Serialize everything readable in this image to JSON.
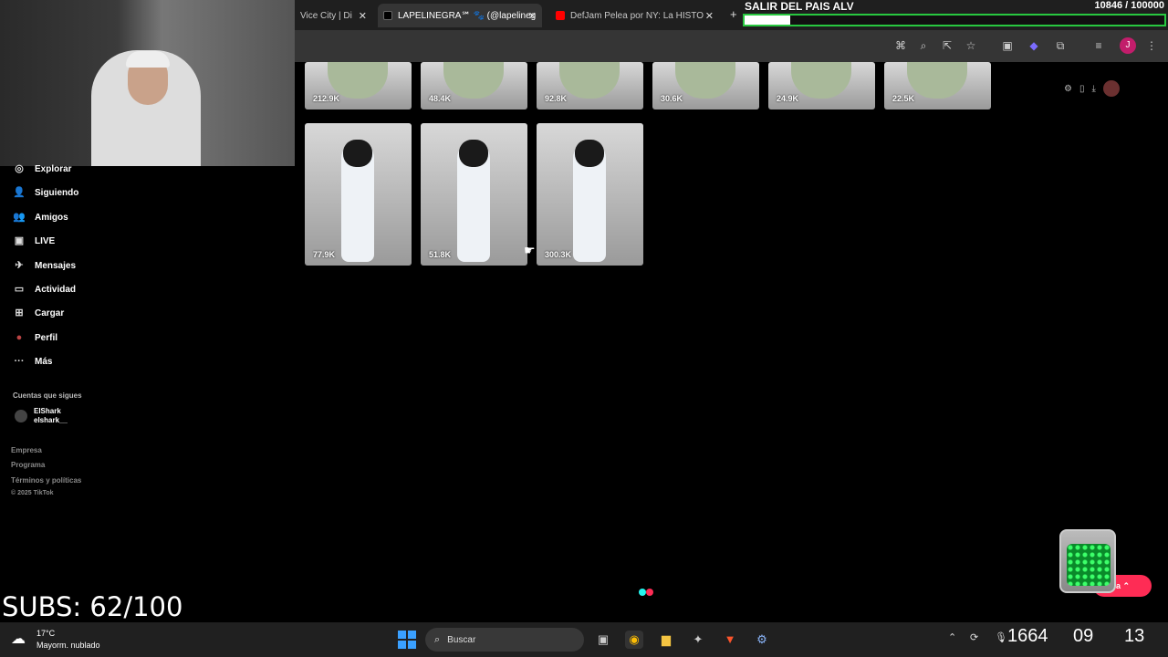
{
  "tabs": [
    {
      "title": "Vice City | Di",
      "active": false
    },
    {
      "title": "LAPELINEGRA℠ 🐾 (@lapelineg",
      "active": true
    },
    {
      "title": "DefJam Pelea por NY: La HISTO",
      "active": false
    }
  ],
  "goal": {
    "title": "SALIR DEL PAIS ALV",
    "count": "10846  / 100000",
    "progress": 0.108
  },
  "sidebar": {
    "items": [
      {
        "icon": "compass-icon",
        "glyph": "◎",
        "label": "Explorar"
      },
      {
        "icon": "following-icon",
        "glyph": "👤",
        "label": "Siguiendo"
      },
      {
        "icon": "friends-icon",
        "glyph": "👥",
        "label": "Amigos"
      },
      {
        "icon": "live-icon",
        "glyph": "▣",
        "label": "LIVE"
      },
      {
        "icon": "messages-icon",
        "glyph": "✈",
        "label": "Mensajes"
      },
      {
        "icon": "activity-icon",
        "glyph": "▭",
        "label": "Actividad"
      },
      {
        "icon": "upload-icon",
        "glyph": "⊞",
        "label": "Cargar"
      },
      {
        "icon": "profile-icon",
        "glyph": "●",
        "label": "Perfil"
      },
      {
        "icon": "more-icon",
        "glyph": "···",
        "label": "Más"
      }
    ],
    "following_header": "Cuentas que sigues",
    "following": [
      {
        "name": "ElShark",
        "handle": "elshark__"
      }
    ],
    "footer": [
      "Empresa",
      "Programa",
      "Términos y políticas",
      "© 2025 TikTok"
    ]
  },
  "videos_top": [
    "212.9K",
    "48.4K",
    "92.8K",
    "30.6K",
    "24.9K",
    "22.5K"
  ],
  "videos_bottom": [
    "77.9K",
    "51.8K",
    "300.3K"
  ],
  "subs_counter": "SUBS: 62/100",
  "pill_label": "ora ⌃",
  "taskbar": {
    "weather_temp": "17°C",
    "weather_desc": "Mayorm. nublado",
    "search_placeholder": "Buscar",
    "clock_overlay": "1664",
    "clock_time": "09",
    "clock_seconds": "13"
  },
  "profile_initial": "J",
  "colors": {
    "goal_border": "#28c840",
    "tiktok_pink": "#fe2c55",
    "tiktok_cyan": "#25f4ee"
  }
}
